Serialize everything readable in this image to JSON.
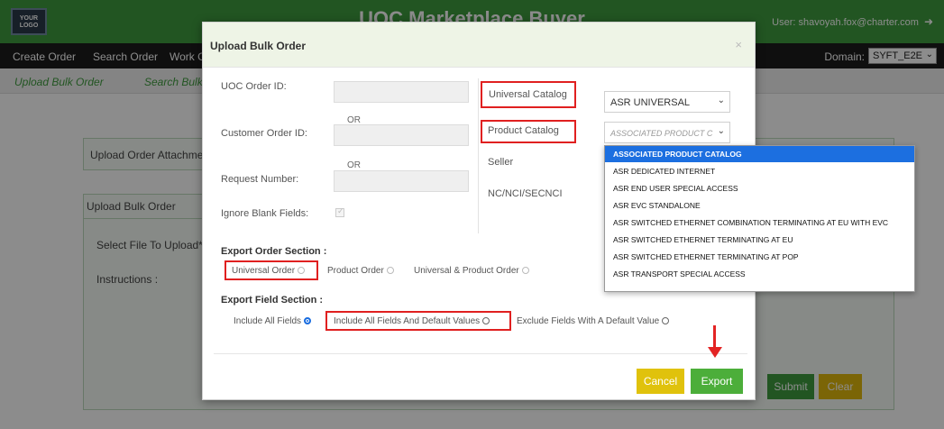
{
  "app": {
    "logo_text": "YOUR LOGO",
    "title": "UOC Marketplace Buyer",
    "user_label": "User: shavoyah.fox@charter.com",
    "logout_icon": "logout-icon"
  },
  "nav": {
    "items": [
      "Create Order",
      "Search Order",
      "Work G"
    ],
    "domain_label": "Domain:",
    "domain_value": "SYFT_E2E"
  },
  "subnav": {
    "items": [
      "Upload Bulk Order",
      "Search Bulk"
    ]
  },
  "background": {
    "attachment_title": "Upload Order Attachment",
    "bulk_title": "Upload Bulk Order",
    "select_file_label": "Select File To Upload* :",
    "instructions_label": "Instructions :",
    "submit_label": "Submit",
    "clear_label": "Clear"
  },
  "modal": {
    "title": "Upload Bulk Order",
    "close_icon": "×",
    "fields": {
      "uoc_order_id": "UOC Order ID:",
      "customer_order_id": "Customer Order ID:",
      "request_number": "Request Number:",
      "ignore_blank": "Ignore Blank Fields:",
      "or_1": "OR",
      "or_2": "OR"
    },
    "right": {
      "universal_catalog_label": "Universal Catalog",
      "universal_catalog_value": "ASR UNIVERSAL",
      "product_catalog_label": "Product Catalog",
      "product_catalog_value": "ASSOCIATED PRODUCT C",
      "seller_label": "Seller",
      "nc_label": "NC/NCI/SECNCI"
    },
    "export_order": {
      "title": "Export Order Section :",
      "options": [
        "Universal Order",
        "Product Order",
        "Universal & Product Order"
      ]
    },
    "export_field": {
      "title": "Export Field Section :",
      "options": [
        "Include All Fields",
        "Include All Fields And Default Values",
        "Exclude Fields With A Default Value"
      ]
    },
    "cancel_label": "Cancel",
    "export_label": "Export"
  },
  "dropdown": {
    "options": [
      "ASSOCIATED PRODUCT CATALOG",
      "ASR DEDICATED INTERNET",
      "ASR END USER SPECIAL ACCESS",
      "ASR EVC STANDALONE",
      "ASR SWITCHED ETHERNET COMBINATION TERMINATING AT EU WITH EVC",
      "ASR SWITCHED ETHERNET TERMINATING AT EU",
      "ASR SWITCHED ETHERNET TERMINATING AT POP",
      "ASR TRANSPORT SPECIAL ACCESS"
    ],
    "selected_index": 0
  },
  "colors": {
    "brand_green": "#3f9c3e",
    "highlight_red": "#e02020",
    "cancel_yellow": "#e0c20c",
    "export_green": "#4cae3a",
    "selection_blue": "#1c6fe0"
  }
}
